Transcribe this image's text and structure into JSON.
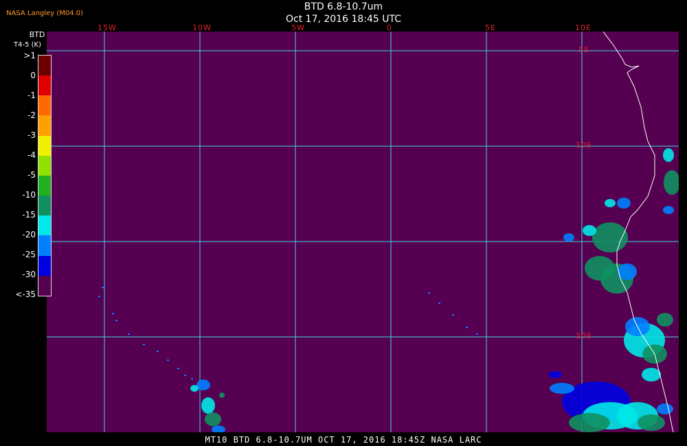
{
  "header": {
    "title": "BTD 6.8-10.7um",
    "datetime": "Oct 17, 2016 18:45 UTC",
    "credit": "NASA Langley (M04.0)"
  },
  "legend": {
    "title": "BTD",
    "subtitle": "T4-5 (K)",
    "labels": [
      ">1",
      "0",
      "-1",
      "-2",
      "-3",
      "-4",
      "-5",
      "-10",
      "-15",
      "-20",
      "-25",
      "-30",
      "<-35"
    ],
    "colors": [
      "#6a0000",
      "#e00000",
      "#ff6a00",
      "#ffa000",
      "#f0f000",
      "#90e000",
      "#20b020",
      "#109060",
      "#00e8e8",
      "#0080ff",
      "#0000e0",
      "#550050"
    ]
  },
  "map": {
    "background": "#550050",
    "grid_color": "#40d8e8",
    "coast_color": "#ffffff",
    "lon_labels": [
      "15W",
      "10W",
      "5W",
      "0",
      "5E",
      "10E"
    ],
    "lat_labels": [
      "5S",
      "10S",
      "20S"
    ]
  },
  "footer": {
    "text": "MT10  BTD 6.8-10.7UM  OCT 17, 2016 18:45Z  NASA LARC"
  }
}
